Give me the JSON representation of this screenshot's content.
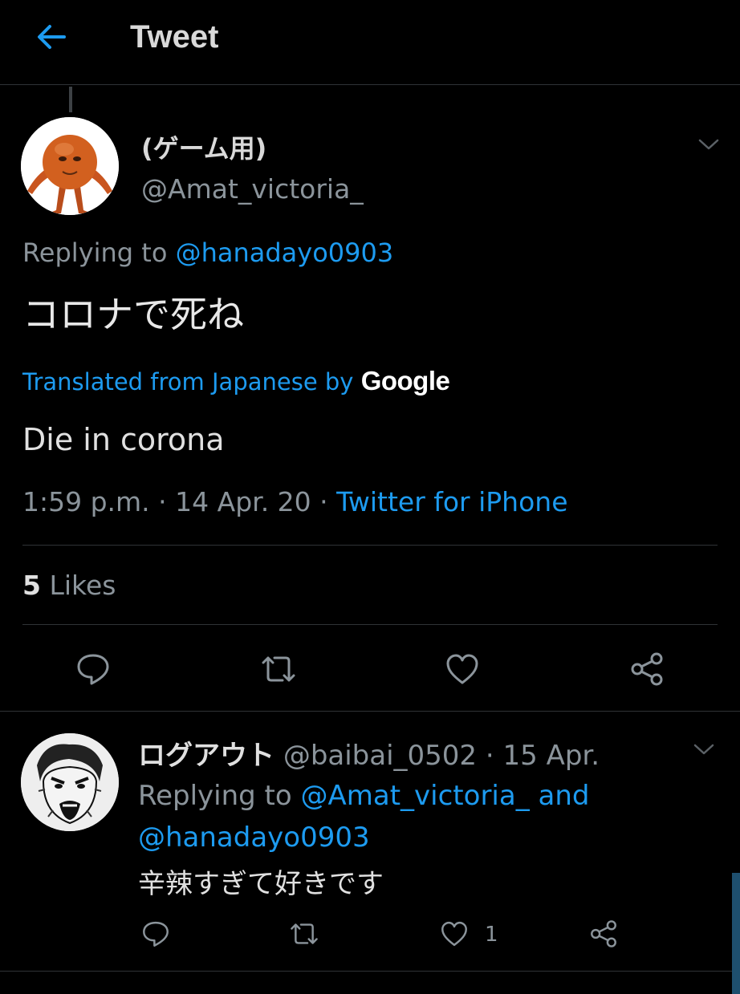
{
  "header": {
    "title": "Tweet"
  },
  "tweet": {
    "display_name": "(ゲーム用)",
    "handle": "@Amat_victoria_",
    "replying_prefix": "Replying to ",
    "replying_to": "@hanadayo0903",
    "text": "コロナで死ね",
    "translated_label": "Translated from Japanese by ",
    "translator": "Google",
    "translation": "Die in corona",
    "time": "1:59 p.m.",
    "date": "14 Apr. 20",
    "separator": " · ",
    "source": "Twitter for iPhone",
    "likes_count": "5",
    "likes_label": " Likes"
  },
  "reply": {
    "display_name": "ログアウト",
    "handle": "@baibai_0502",
    "date": "15 Apr.",
    "separator": " · ",
    "replying_prefix": "Replying to ",
    "replying_to_1": "@Amat_victoria_",
    "and": " and ",
    "replying_to_2": "@hanadayo0903",
    "text": "辛辣すぎて好きです",
    "like_count": "1"
  },
  "colors": {
    "background": "#000000",
    "link": "#1d9bf0",
    "secondary_text": "#8b949b",
    "divider": "#2f3336"
  },
  "icons": [
    "back-arrow-icon",
    "chevron-down-icon",
    "reply-icon",
    "retweet-icon",
    "like-icon",
    "share-icon"
  ]
}
